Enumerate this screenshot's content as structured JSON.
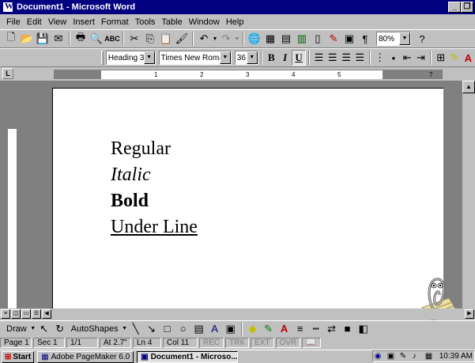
{
  "window": {
    "title": "Document1 - Microsoft Word",
    "ctrl_min": "_",
    "ctrl_restore": "❐"
  },
  "menu": [
    "File",
    "Edit",
    "View",
    "Insert",
    "Format",
    "Tools",
    "Table",
    "Window",
    "Help"
  ],
  "standard_toolbar": {
    "zoom": "80%"
  },
  "format_toolbar": {
    "style": "Heading 3",
    "font": "Times New Roman",
    "size": "36",
    "bold_label": "B",
    "italic_label": "I",
    "underline_label": "U"
  },
  "ruler": {
    "numbers": [
      "1",
      "2",
      "3",
      "4",
      "5",
      "7"
    ],
    "tab_selector": "L"
  },
  "document": {
    "lines": [
      "Regular",
      "Italic",
      "Bold",
      "Under Line"
    ]
  },
  "drawing_toolbar": {
    "draw_label": "Draw",
    "autoshapes_label": "AutoShapes"
  },
  "status": {
    "page": "Page 1",
    "sec": "Sec 1",
    "pages": "1/1",
    "at": "At 2.7\"",
    "ln": "Ln 4",
    "col": "Col 11",
    "rec": "REC",
    "trk": "TRK",
    "ext": "EXT",
    "ovr": "OVR"
  },
  "taskbar": {
    "start_label": "Start",
    "task1": "Adobe PageMaker 6.0",
    "task2": "Document1 - Microso...",
    "clock": "10:39 AM"
  },
  "colors": {
    "titlebar": "#000080",
    "face": "#c0c0c0",
    "desktop_gray": "#808080"
  }
}
